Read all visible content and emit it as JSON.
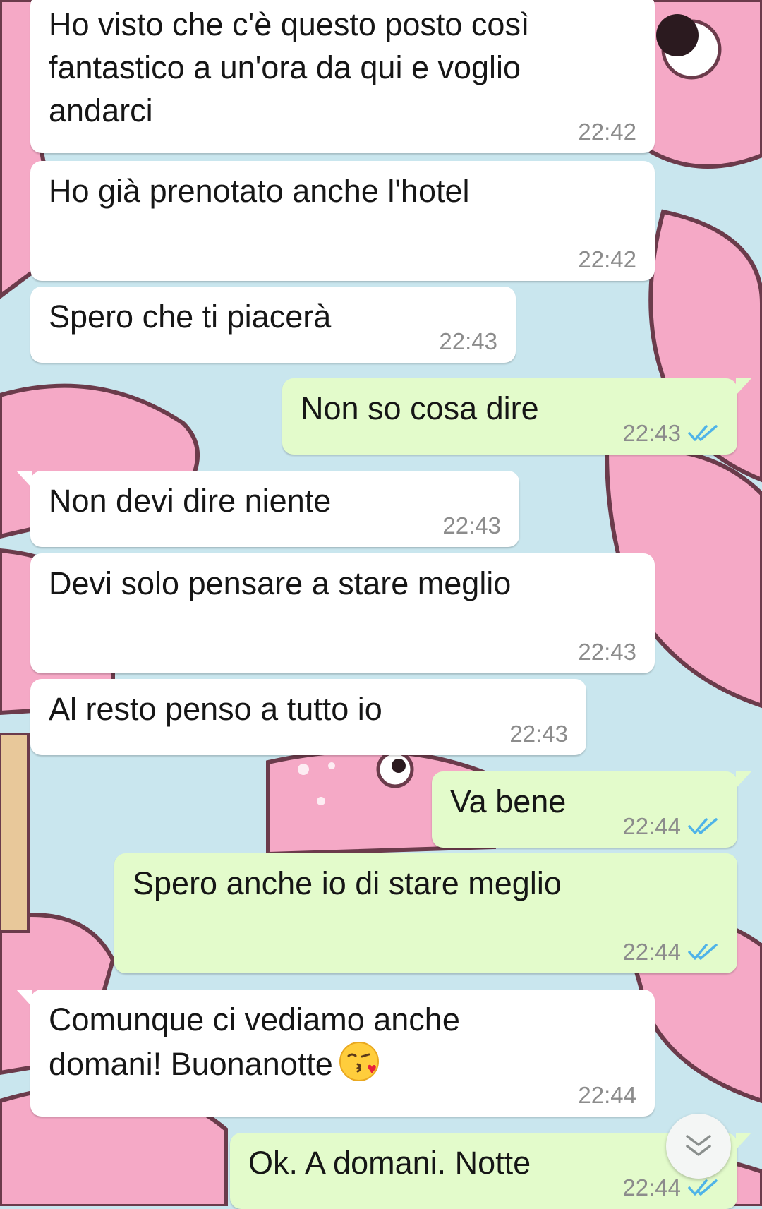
{
  "colors": {
    "incoming_bubble": "#ffffff",
    "outgoing_bubble": "#e3fbcb",
    "timestamp": "#8c8c8c",
    "read_ticks": "#4fb3e8",
    "wallpaper_pink": "#f5a9c6",
    "wallpaper_blue": "#c9e6ee"
  },
  "icons": {
    "read_status": "double-check-icon",
    "scroll": "double-chevron-down-icon",
    "emoji": "face-blowing-kiss-emoji"
  },
  "messages": [
    {
      "direction": "in",
      "text": "Ho visto che c'è questo posto così\nfantastico a un'ora da qui e voglio\nandarci",
      "time": "22:42"
    },
    {
      "direction": "in",
      "text": "Ho già prenotato anche l'hotel",
      "time": "22:42"
    },
    {
      "direction": "in",
      "text": "Spero che ti piacerà",
      "time": "22:43"
    },
    {
      "direction": "out",
      "text": "Non so cosa dire",
      "time": "22:43",
      "status": "read"
    },
    {
      "direction": "in",
      "text": "Non devi dire niente",
      "time": "22:43"
    },
    {
      "direction": "in",
      "text": "Devi solo pensare a stare meglio",
      "time": "22:43"
    },
    {
      "direction": "in",
      "text": "Al resto penso a tutto io",
      "time": "22:43"
    },
    {
      "direction": "out",
      "text": "Va bene",
      "time": "22:44",
      "status": "read"
    },
    {
      "direction": "out",
      "text": "Spero anche io di stare meglio",
      "time": "22:44",
      "status": "read"
    },
    {
      "direction": "in",
      "text": "Comunque ci vediamo anche\ndomani! Buonanotte",
      "time": "22:44",
      "emoji": "😘"
    },
    {
      "direction": "out",
      "text": "Ok. A domani. Notte",
      "time": "22:44",
      "status": "read"
    }
  ]
}
